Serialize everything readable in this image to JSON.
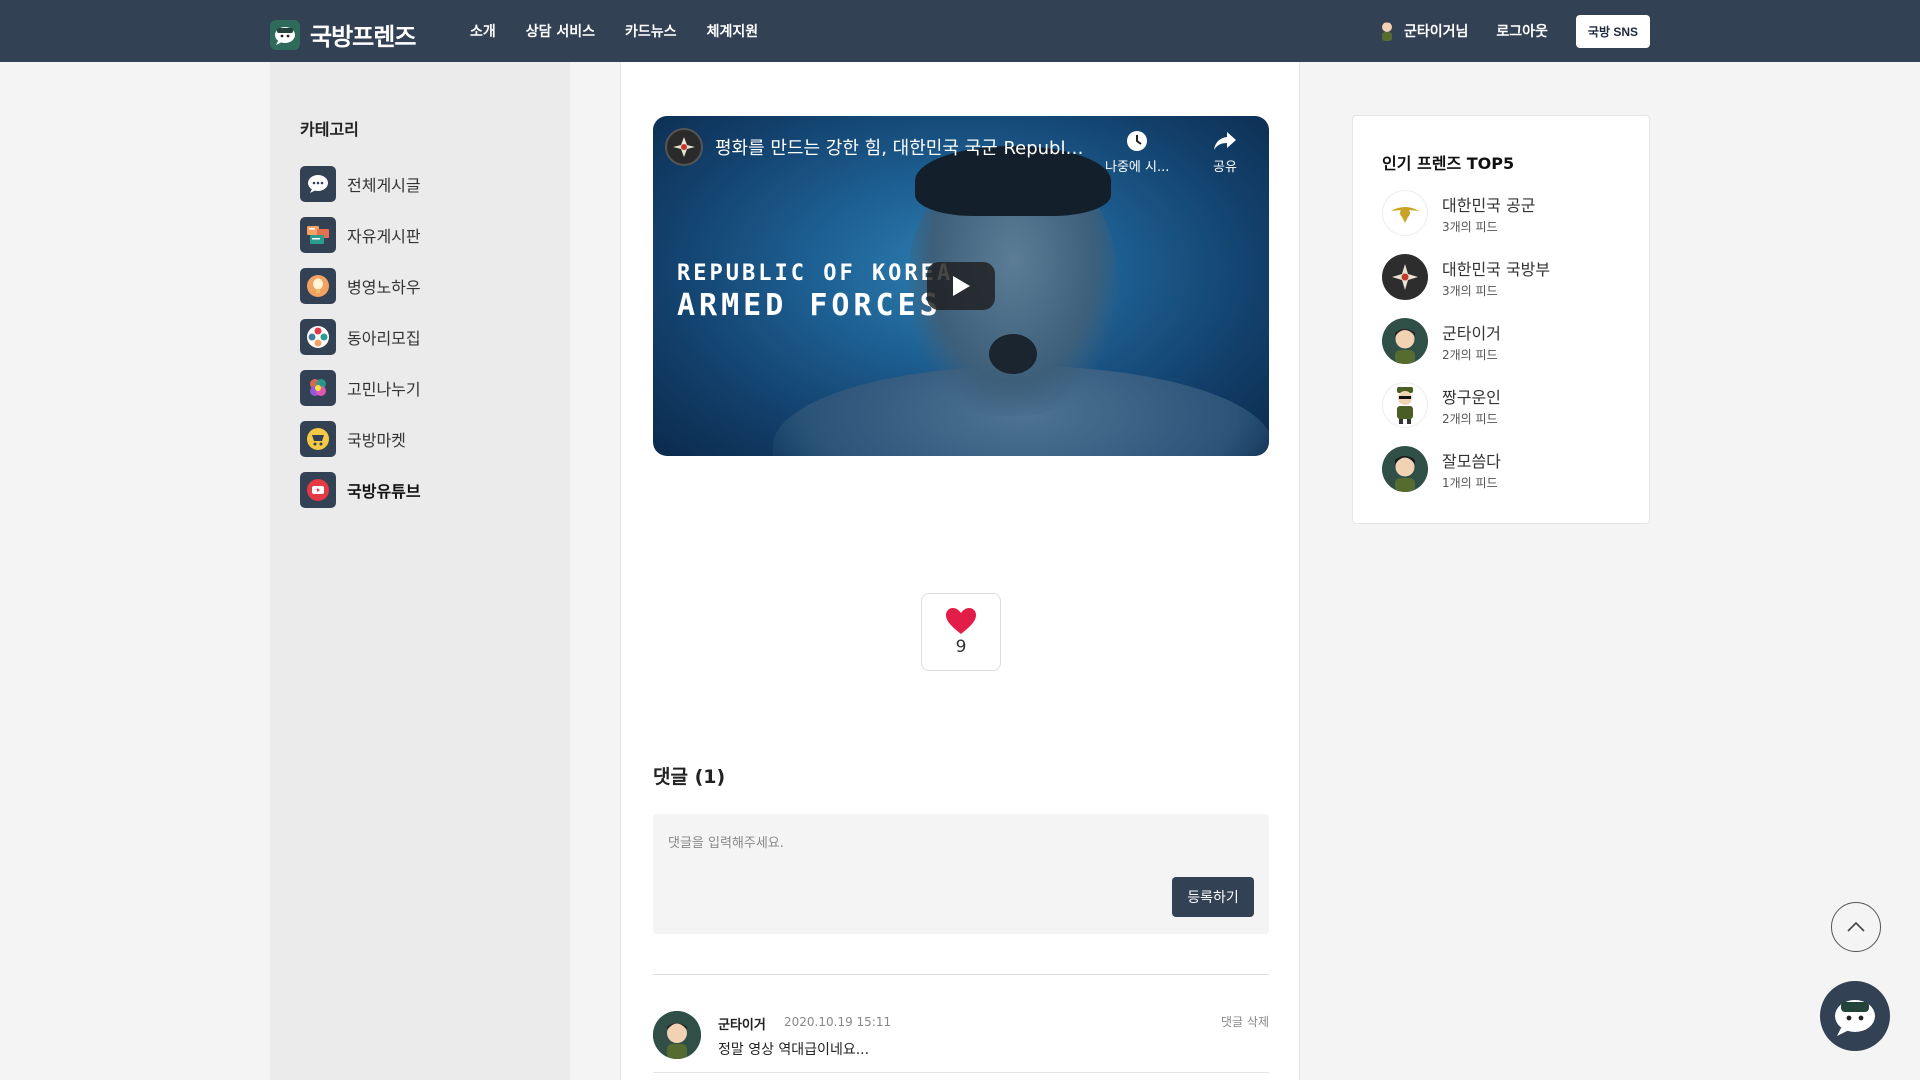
{
  "brand": {
    "name": "국방프렌즈"
  },
  "nav": {
    "items": [
      {
        "label": "소개"
      },
      {
        "label": "상담 서비스"
      },
      {
        "label": "카드뉴스"
      },
      {
        "label": "체계지원"
      }
    ],
    "user_label": "군타이거님",
    "logout_label": "로그아웃",
    "sns_label": "국방 SNS"
  },
  "sidebar": {
    "title": "카테고리",
    "items": [
      {
        "label": "전체게시글",
        "icon": "speech-bubble-icon"
      },
      {
        "label": "자유게시판",
        "icon": "board-icon"
      },
      {
        "label": "병영노하우",
        "icon": "lightbulb-icon"
      },
      {
        "label": "동아리모집",
        "icon": "circle-group-icon"
      },
      {
        "label": "고민나누기",
        "icon": "colorful-petals-icon"
      },
      {
        "label": "국방마켓",
        "icon": "shopping-cart-icon"
      },
      {
        "label": "국방유튜브",
        "icon": "youtube-icon",
        "active": true
      }
    ]
  },
  "video": {
    "title": "평화를 만드는 강한 힘, 대한민국 국군 Republi...",
    "watch_later_label": "나중에 시...",
    "share_label": "공유",
    "overlay_line1": "REPUBLIC OF KOREA",
    "overlay_line2": "ARMED FORCES"
  },
  "like": {
    "count": "9",
    "color": "#e11d48"
  },
  "comments": {
    "title": "댓글 (1)",
    "placeholder": "댓글을 입력해주세요.",
    "submit_label": "등록하기",
    "items": [
      {
        "author": "군타이거",
        "date": "2020.10.19 15:11",
        "text": "정말 영상 역대급이네요...",
        "delete_label": "댓글 삭제"
      }
    ]
  },
  "ranking": {
    "title": "인기 프렌즈 TOP5",
    "items": [
      {
        "name": "대한민국 공군",
        "feeds": "3개의 피드"
      },
      {
        "name": "대한민국 국방부",
        "feeds": "3개의 피드"
      },
      {
        "name": "군타이거",
        "feeds": "2개의 피드"
      },
      {
        "name": "짱구운인",
        "feeds": "2개의 피드"
      },
      {
        "name": "잘모씀다",
        "feeds": "1개의 피드"
      }
    ]
  },
  "colors": {
    "navbar": "#334155",
    "sidebar_bg": "#ebebeb",
    "accent": "#334155",
    "heart": "#e11d48"
  }
}
